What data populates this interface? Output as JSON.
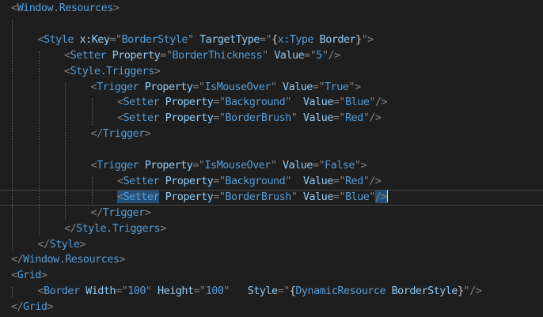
{
  "colors": {
    "background": "#1e1e1e",
    "tag_delimiter": "#808080",
    "element": "#569cd6",
    "attribute": "#92caf4",
    "value": "#569cd6",
    "markup_extension": "#c8c8c8",
    "selection": "#264f78",
    "indent_guide": "#5a5a5a",
    "current_line_border": "#464646"
  },
  "editor": {
    "lines": [
      {
        "indent": 0,
        "tokens": [
          [
            "t",
            "<"
          ],
          [
            "e",
            "Window.Resources"
          ],
          [
            "t",
            ">"
          ]
        ]
      },
      {
        "indent": 0,
        "tokens": []
      },
      {
        "indent": 1,
        "tokens": [
          [
            "t",
            "<"
          ],
          [
            "e",
            "Style"
          ],
          [
            "a",
            " x:Key"
          ],
          [
            "t",
            "="
          ],
          [
            "q",
            "\""
          ],
          [
            "v",
            "BorderStyle"
          ],
          [
            "q",
            "\""
          ],
          [
            "a",
            " TargetType"
          ],
          [
            "t",
            "="
          ],
          [
            "q",
            "\""
          ],
          [
            "m",
            "{"
          ],
          [
            "e",
            "x:Type"
          ],
          [
            "a",
            " Border"
          ],
          [
            "m",
            "}"
          ],
          [
            "q",
            "\""
          ],
          [
            "t",
            ">"
          ]
        ]
      },
      {
        "indent": 2,
        "tokens": [
          [
            "t",
            "<"
          ],
          [
            "e",
            "Setter"
          ],
          [
            "a",
            " Property"
          ],
          [
            "t",
            "="
          ],
          [
            "q",
            "\""
          ],
          [
            "v",
            "BorderThickness"
          ],
          [
            "q",
            "\""
          ],
          [
            "a",
            " Value"
          ],
          [
            "t",
            "="
          ],
          [
            "q",
            "\""
          ],
          [
            "v",
            "5"
          ],
          [
            "q",
            "\""
          ],
          [
            "t",
            "/>"
          ]
        ]
      },
      {
        "indent": 2,
        "tokens": [
          [
            "t",
            "<"
          ],
          [
            "e",
            "Style.Triggers"
          ],
          [
            "t",
            ">"
          ]
        ]
      },
      {
        "indent": 3,
        "tokens": [
          [
            "t",
            "<"
          ],
          [
            "e",
            "Trigger"
          ],
          [
            "a",
            " Property"
          ],
          [
            "t",
            "="
          ],
          [
            "q",
            "\""
          ],
          [
            "v",
            "IsMouseOver"
          ],
          [
            "q",
            "\""
          ],
          [
            "a",
            " Value"
          ],
          [
            "t",
            "="
          ],
          [
            "q",
            "\""
          ],
          [
            "v",
            "True"
          ],
          [
            "q",
            "\""
          ],
          [
            "t",
            ">"
          ]
        ]
      },
      {
        "indent": 4,
        "tokens": [
          [
            "t",
            "<"
          ],
          [
            "e",
            "Setter"
          ],
          [
            "a",
            " Property"
          ],
          [
            "t",
            "="
          ],
          [
            "q",
            "\""
          ],
          [
            "v",
            "Background"
          ],
          [
            "q",
            "\""
          ],
          [
            "a",
            "  Value"
          ],
          [
            "t",
            "="
          ],
          [
            "q",
            "\""
          ],
          [
            "v",
            "Blue"
          ],
          [
            "q",
            "\""
          ],
          [
            "t",
            "/>"
          ]
        ]
      },
      {
        "indent": 4,
        "tokens": [
          [
            "t",
            "<"
          ],
          [
            "e",
            "Setter"
          ],
          [
            "a",
            " Property"
          ],
          [
            "t",
            "="
          ],
          [
            "q",
            "\""
          ],
          [
            "v",
            "BorderBrush"
          ],
          [
            "q",
            "\""
          ],
          [
            "a",
            " Value"
          ],
          [
            "t",
            "="
          ],
          [
            "q",
            "\""
          ],
          [
            "v",
            "Red"
          ],
          [
            "q",
            "\""
          ],
          [
            "t",
            "/>"
          ]
        ]
      },
      {
        "indent": 3,
        "tokens": [
          [
            "t",
            "</"
          ],
          [
            "e",
            "Trigger"
          ],
          [
            "t",
            ">"
          ]
        ]
      },
      {
        "indent": 0,
        "tokens": []
      },
      {
        "indent": 3,
        "tokens": [
          [
            "t",
            "<"
          ],
          [
            "e",
            "Trigger"
          ],
          [
            "a",
            " Property"
          ],
          [
            "t",
            "="
          ],
          [
            "q",
            "\""
          ],
          [
            "v",
            "IsMouseOver"
          ],
          [
            "q",
            "\""
          ],
          [
            "a",
            " Value"
          ],
          [
            "t",
            "="
          ],
          [
            "q",
            "\""
          ],
          [
            "v",
            "False"
          ],
          [
            "q",
            "\""
          ],
          [
            "t",
            ">"
          ]
        ]
      },
      {
        "indent": 4,
        "tokens": [
          [
            "t",
            "<"
          ],
          [
            "e",
            "Setter"
          ],
          [
            "a",
            " Property"
          ],
          [
            "t",
            "="
          ],
          [
            "q",
            "\""
          ],
          [
            "v",
            "Background"
          ],
          [
            "q",
            "\""
          ],
          [
            "a",
            "  Value"
          ],
          [
            "t",
            "="
          ],
          [
            "q",
            "\""
          ],
          [
            "v",
            "Red"
          ],
          [
            "q",
            "\""
          ],
          [
            "t",
            "/>"
          ]
        ]
      },
      {
        "indent": 4,
        "current": true,
        "tokens": [
          [
            "st",
            "<"
          ],
          [
            "se",
            "Setter"
          ],
          [
            "a",
            " Property"
          ],
          [
            "t",
            "="
          ],
          [
            "q",
            "\""
          ],
          [
            "v",
            "BorderBrush"
          ],
          [
            "q",
            "\""
          ],
          [
            "a",
            " Value"
          ],
          [
            "t",
            "="
          ],
          [
            "q",
            "\""
          ],
          [
            "v",
            "Blue"
          ],
          [
            "q",
            "\""
          ],
          [
            "st",
            "/>"
          ],
          [
            "caret",
            ""
          ]
        ]
      },
      {
        "indent": 3,
        "tokens": [
          [
            "t",
            "</"
          ],
          [
            "e",
            "Trigger"
          ],
          [
            "t",
            ">"
          ]
        ]
      },
      {
        "indent": 2,
        "tokens": [
          [
            "t",
            "</"
          ],
          [
            "e",
            "Style.Triggers"
          ],
          [
            "t",
            ">"
          ]
        ]
      },
      {
        "indent": 1,
        "tokens": [
          [
            "t",
            "</"
          ],
          [
            "e",
            "Style"
          ],
          [
            "t",
            ">"
          ]
        ]
      },
      {
        "indent": 0,
        "tokens": [
          [
            "t",
            "</"
          ],
          [
            "e",
            "Window.Resources"
          ],
          [
            "t",
            ">"
          ]
        ]
      },
      {
        "indent": 0,
        "tokens": [
          [
            "t",
            "<"
          ],
          [
            "e",
            "Grid"
          ],
          [
            "t",
            ">"
          ]
        ]
      },
      {
        "indent": 1,
        "tokens": [
          [
            "t",
            "<"
          ],
          [
            "e",
            "Border"
          ],
          [
            "a",
            " Width"
          ],
          [
            "t",
            "="
          ],
          [
            "q",
            "\""
          ],
          [
            "v",
            "100"
          ],
          [
            "q",
            "\""
          ],
          [
            "a",
            " Height"
          ],
          [
            "t",
            "="
          ],
          [
            "q",
            "\""
          ],
          [
            "v",
            "100"
          ],
          [
            "q",
            "\""
          ],
          [
            "a",
            "   Style"
          ],
          [
            "t",
            "="
          ],
          [
            "q",
            "\""
          ],
          [
            "m",
            "{"
          ],
          [
            "e",
            "DynamicResource"
          ],
          [
            "a",
            " BorderStyle"
          ],
          [
            "m",
            "}"
          ],
          [
            "q",
            "\""
          ],
          [
            "t",
            "/>"
          ]
        ]
      },
      {
        "indent": 0,
        "tokens": [
          [
            "t",
            "</"
          ],
          [
            "e",
            "Grid"
          ],
          [
            "t",
            ">"
          ]
        ]
      }
    ]
  }
}
